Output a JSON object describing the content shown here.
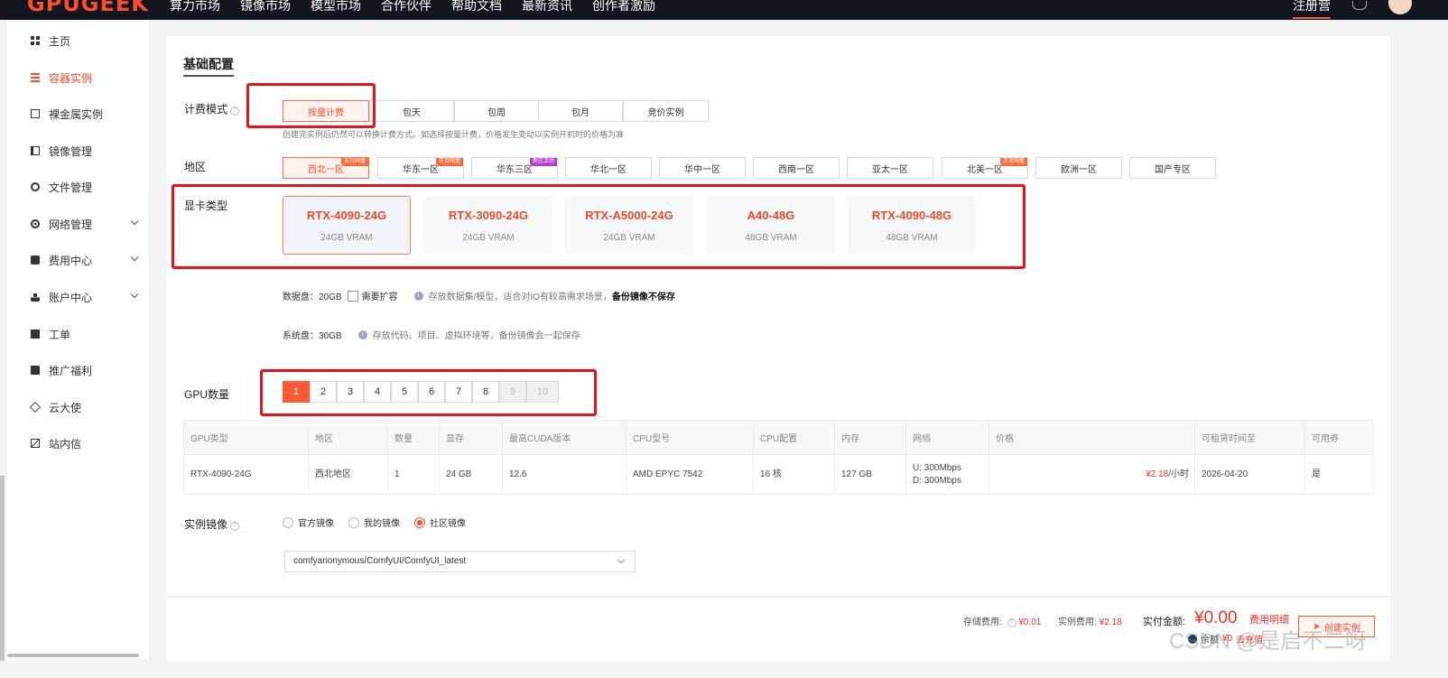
{
  "topbar": {
    "logo": "GPUGEEK",
    "nav": [
      "算力市场",
      "镜像市场",
      "模型市场",
      "合作伙伴",
      "帮助文档",
      "最新资讯",
      "创作者激励"
    ],
    "register": "注册营"
  },
  "sidebar": {
    "items": [
      {
        "label": "主页",
        "icon": "grid-icon"
      },
      {
        "label": "容器实例",
        "icon": "list-icon"
      },
      {
        "label": "裸金属实例",
        "icon": "server-icon"
      },
      {
        "label": "镜像管理",
        "icon": "film-icon"
      },
      {
        "label": "文件管理",
        "icon": "folder-icon"
      },
      {
        "label": "网络管理",
        "icon": "globe-icon"
      },
      {
        "label": "费用中心",
        "icon": "money-icon"
      },
      {
        "label": "账户中心",
        "icon": "user-icon"
      },
      {
        "label": "工单",
        "icon": "doc-icon"
      },
      {
        "label": "推广福利",
        "icon": "gift-icon"
      },
      {
        "label": "云大使",
        "icon": "diamond-icon"
      },
      {
        "label": "站内信",
        "icon": "mail-icon"
      }
    ]
  },
  "main": {
    "section_title": "基础配置",
    "billing": {
      "label": "计费模式",
      "options": [
        "按量计费",
        "包天",
        "包周",
        "包月",
        "竞价实例"
      ],
      "hint": "创建完实例后仍然可以转换计费方式。如选择按量计费，价格发生变动以实例开机时的价格为准"
    },
    "region": {
      "label": "地区",
      "options": [
        {
          "name": "西北一区",
          "badge": "支持网盘"
        },
        {
          "name": "华东一区",
          "badge": "支持网盘"
        },
        {
          "name": "华东三区",
          "badge": "新区活动"
        },
        {
          "name": "华北一区",
          "badge": ""
        },
        {
          "name": "华中一区",
          "badge": ""
        },
        {
          "name": "西南一区",
          "badge": ""
        },
        {
          "name": "亚太一区",
          "badge": ""
        },
        {
          "name": "北美一区",
          "badge": "支持网盘"
        },
        {
          "name": "欧洲一区",
          "badge": ""
        },
        {
          "name": "国产专区",
          "badge": ""
        }
      ]
    },
    "gpu_type": {
      "label": "显卡类型",
      "cards": [
        {
          "name": "RTX-4090-24G",
          "vram": "24GB VRAM"
        },
        {
          "name": "RTX-3090-24G",
          "vram": "24GB VRAM"
        },
        {
          "name": "RTX-A5000-24G",
          "vram": "24GB VRAM"
        },
        {
          "name": "A40-48G",
          "vram": "48GB VRAM"
        },
        {
          "name": "RTX-4090-48G",
          "vram": "48GB VRAM"
        }
      ]
    },
    "data_disk": {
      "label": "数据盘：20GB",
      "checkbox": "需要扩容",
      "desc": "存放数据集/模型，适合对IO有较高需求场景，",
      "bold": "备份镜像不保存"
    },
    "sys_disk": {
      "label": "系统盘：30GB",
      "desc": "存放代码、项目、虚拟环境等，备份镜像会一起保存"
    },
    "gpu_count": {
      "label": "GPU数量",
      "options": [
        "1",
        "2",
        "3",
        "4",
        "5",
        "6",
        "7",
        "8",
        "9",
        "10"
      ]
    },
    "table": {
      "headers": [
        "GPU类型",
        "地区",
        "数量",
        "显存",
        "最高CUDA版本",
        "CPU型号",
        "CPU配置",
        "内存",
        "网络",
        "价格",
        "可租赁时间至",
        "可用券"
      ],
      "row": {
        "gpu": "RTX-4090-24G",
        "region": "西北地区",
        "count": "1",
        "vram": "24 GB",
        "cuda": "12.6",
        "cpu_model": "AMD EPYC 7542",
        "cpu_cfg": "16 核",
        "mem": "127 GB",
        "net_up": "U: 300Mbps",
        "net_down": "D: 300Mbps",
        "price": "¥2.18",
        "price_unit": "/小时",
        "until": "2026-04-20",
        "coupon": "是"
      }
    },
    "image": {
      "label": "实例镜像",
      "options": [
        "官方镜像",
        "我的镜像",
        "社区镜像"
      ],
      "selected": "comfyanonymous/ComfyUI/ComfyUI_latest"
    }
  },
  "footer": {
    "storage_label": "存储费用:",
    "storage_val": "¥0.01",
    "instance_label": "实例费用:",
    "instance_val": "¥2.18",
    "total_label": "实付金额:",
    "total": "¥0.00",
    "detail": "费用明细",
    "create": "创建实例",
    "gold_label": "余额",
    "gold_val": "¥0",
    "gold_action": "去充值",
    "watermark": "CSDN @是启不二呀"
  },
  "colors": {
    "accent": "#ff4a2a",
    "annotation": "#e8121f"
  }
}
